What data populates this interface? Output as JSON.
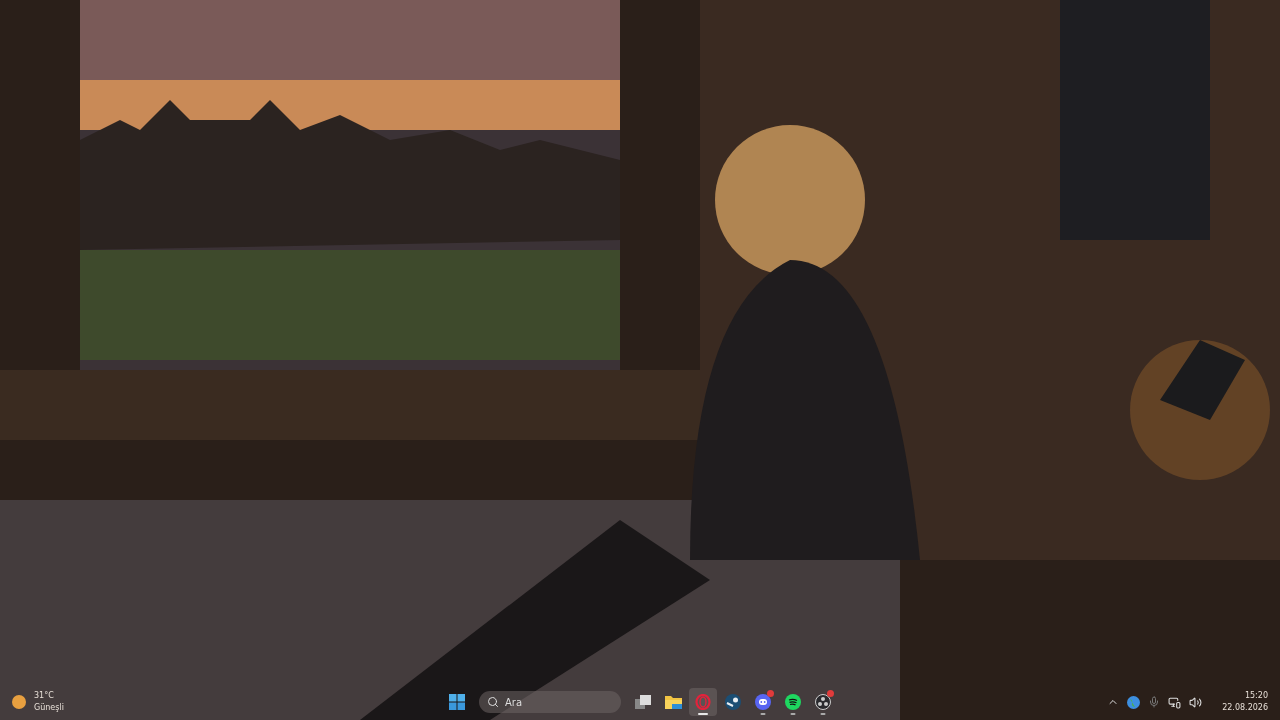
{
  "weather": {
    "temperature": "31°C",
    "condition": "Güneşli"
  },
  "search": {
    "placeholder": "Ara"
  },
  "apps": [
    {
      "kind": "start",
      "selected": false,
      "running": false,
      "badge": false
    },
    {
      "kind": "taskview",
      "selected": false,
      "running": false,
      "badge": false
    },
    {
      "kind": "explorer",
      "selected": false,
      "running": false,
      "badge": false
    },
    {
      "kind": "opera",
      "selected": true,
      "running": true,
      "badge": false
    },
    {
      "kind": "steam",
      "selected": false,
      "running": false,
      "badge": false
    },
    {
      "kind": "discord",
      "selected": false,
      "running": true,
      "badge": true
    },
    {
      "kind": "spotify",
      "selected": false,
      "running": true,
      "badge": false
    },
    {
      "kind": "obs",
      "selected": false,
      "running": true,
      "badge": true
    }
  ],
  "tray": [
    {
      "kind": "chevron"
    },
    {
      "kind": "globe"
    },
    {
      "kind": "mic"
    },
    {
      "kind": "network"
    },
    {
      "kind": "volume"
    }
  ],
  "clock": {
    "time": "15:20",
    "date": "22.08.2026"
  }
}
